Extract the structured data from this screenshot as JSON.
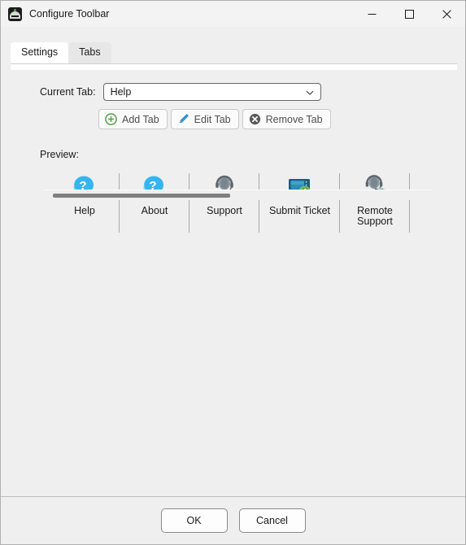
{
  "window": {
    "title": "Configure Toolbar",
    "app_icon": "bridge-icon",
    "controls": {
      "minimize": "minimize-icon",
      "maximize": "maximize-icon",
      "close": "close-icon"
    }
  },
  "tabs": [
    {
      "label": "Settings",
      "state": "selected"
    },
    {
      "label": "Tabs",
      "state": "hovered"
    }
  ],
  "form": {
    "current_tab_label": "Current Tab:",
    "current_tab_value": "Help",
    "current_tab_options": [
      "Help"
    ],
    "dropdown_icon": "chevron-down-icon",
    "buttons": [
      {
        "label": "Add Tab",
        "icon": "plus-circle-icon",
        "color": "#5aa84f"
      },
      {
        "label": "Edit Tab",
        "icon": "pencil-icon",
        "color": "#2a9fd6"
      },
      {
        "label": "Remove Tab",
        "icon": "x-circle-icon",
        "color": "#5b5b5b"
      }
    ]
  },
  "preview": {
    "label": "Preview:",
    "items": [
      {
        "label": "Help",
        "icon": "question-bubble-icon"
      },
      {
        "label": "About",
        "icon": "question-bubble-icon"
      },
      {
        "label": "Support",
        "icon": "headset-person-icon"
      },
      {
        "label": "Submit Ticket",
        "icon": "ticket-arrow-icon"
      },
      {
        "label": "Remote Support",
        "icon": "headset-person-wifi-icon"
      }
    ],
    "insertion_caret_color": "#f0b440"
  },
  "scrollbar": {
    "orientation": "horizontal",
    "thumb_color": "#808080"
  },
  "footer": {
    "ok_label": "OK",
    "cancel_label": "Cancel"
  },
  "colors": {
    "window_bg": "#efefef",
    "titlebar_bg": "#f3f3f3",
    "tabpage_bg": "#ffffff",
    "accent_green": "#22b14c",
    "accent_blue": "#35b5f0",
    "accent_teal": "#1f6f8b"
  }
}
